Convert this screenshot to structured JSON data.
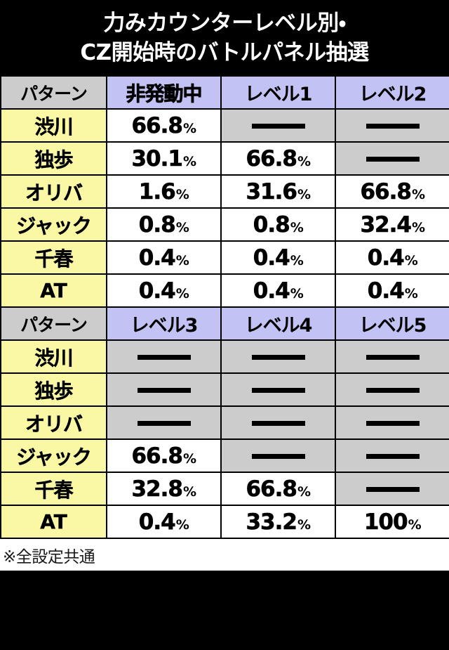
{
  "title": {
    "line1": "力みカウンターレベル別・",
    "line2": "CZ開始時のバトルパネル抽選"
  },
  "colors": {
    "background": "#000000",
    "title_text": "#ffffff",
    "header_pattern_bg": "#cccccc",
    "header_level_bg": "#c2c2f5",
    "row_label_bg": "#fbf8a5",
    "value_bg": "#ffffff",
    "empty_cell_bg": "#cccccc",
    "text": "#000000"
  },
  "footer": {
    "note": "※全設定共通"
  },
  "chart_data": {
    "type": "table",
    "title": "力みカウンターレベル別・CZ開始時のバトルパネル抽選",
    "annotations": [
      "※全設定共通"
    ],
    "row_header_label": "パターン",
    "categories": [
      "渋川",
      "独歩",
      "オリバ",
      "ジャック",
      "千春",
      "AT"
    ],
    "series": [
      {
        "name": "非発動中",
        "values": [
          "66.8%",
          "30.1%",
          "1.6%",
          "0.8%",
          "0.4%",
          "0.4%"
        ]
      },
      {
        "name": "レベル1",
        "values": [
          "—",
          "66.8%",
          "31.6%",
          "0.8%",
          "0.4%",
          "0.4%"
        ]
      },
      {
        "name": "レベル2",
        "values": [
          "—",
          "—",
          "66.8%",
          "32.4%",
          "0.4%",
          "0.4%"
        ]
      },
      {
        "name": "レベル3",
        "values": [
          "—",
          "—",
          "—",
          "66.8%",
          "32.8%",
          "0.4%"
        ]
      },
      {
        "name": "レベル4",
        "values": [
          "—",
          "—",
          "—",
          "—",
          "66.8%",
          "33.2%"
        ]
      },
      {
        "name": "レベル5",
        "values": [
          "—",
          "—",
          "—",
          "—",
          "—",
          "100%"
        ]
      }
    ]
  },
  "blocks": [
    {
      "header": {
        "label": "パターン",
        "cols": [
          "非発動中",
          "レベル1",
          "レベル2"
        ]
      },
      "rows": [
        {
          "label": "渋川",
          "cells": [
            {
              "num": "66.8",
              "pct": "%"
            },
            {
              "dash": true
            },
            {
              "dash": true
            }
          ]
        },
        {
          "label": "独歩",
          "cells": [
            {
              "num": "30.1",
              "pct": "%"
            },
            {
              "num": "66.8",
              "pct": "%"
            },
            {
              "dash": true
            }
          ]
        },
        {
          "label": "オリバ",
          "cells": [
            {
              "num": "1.6",
              "pct": "%"
            },
            {
              "num": "31.6",
              "pct": "%"
            },
            {
              "num": "66.8",
              "pct": "%"
            }
          ]
        },
        {
          "label": "ジャック",
          "cells": [
            {
              "num": "0.8",
              "pct": "%"
            },
            {
              "num": "0.8",
              "pct": "%"
            },
            {
              "num": "32.4",
              "pct": "%"
            }
          ]
        },
        {
          "label": "千春",
          "cells": [
            {
              "num": "0.4",
              "pct": "%"
            },
            {
              "num": "0.4",
              "pct": "%"
            },
            {
              "num": "0.4",
              "pct": "%"
            }
          ]
        },
        {
          "label": "AT",
          "cells": [
            {
              "num": "0.4",
              "pct": "%"
            },
            {
              "num": "0.4",
              "pct": "%"
            },
            {
              "num": "0.4",
              "pct": "%"
            }
          ]
        }
      ]
    },
    {
      "header": {
        "label": "パターン",
        "cols": [
          "レベル3",
          "レベル4",
          "レベル5"
        ]
      },
      "rows": [
        {
          "label": "渋川",
          "cells": [
            {
              "dash": true
            },
            {
              "dash": true
            },
            {
              "dash": true
            }
          ]
        },
        {
          "label": "独歩",
          "cells": [
            {
              "dash": true
            },
            {
              "dash": true
            },
            {
              "dash": true
            }
          ]
        },
        {
          "label": "オリバ",
          "cells": [
            {
              "dash": true
            },
            {
              "dash": true
            },
            {
              "dash": true
            }
          ]
        },
        {
          "label": "ジャック",
          "cells": [
            {
              "num": "66.8",
              "pct": "%"
            },
            {
              "dash": true
            },
            {
              "dash": true
            }
          ]
        },
        {
          "label": "千春",
          "cells": [
            {
              "num": "32.8",
              "pct": "%"
            },
            {
              "num": "66.8",
              "pct": "%"
            },
            {
              "dash": true
            }
          ]
        },
        {
          "label": "AT",
          "cells": [
            {
              "num": "0.4",
              "pct": "%"
            },
            {
              "num": "33.2",
              "pct": "%"
            },
            {
              "num": "100",
              "pct": "%"
            }
          ]
        }
      ]
    }
  ]
}
